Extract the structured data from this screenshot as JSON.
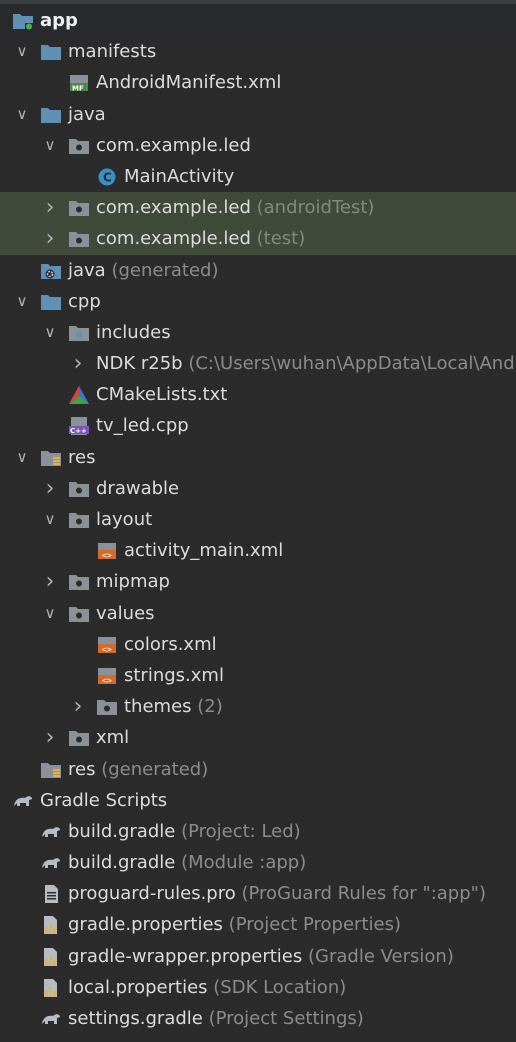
{
  "rows": [
    {
      "label": "app",
      "hint": "",
      "icon": "module-folder-icon",
      "arrow": "none",
      "level": 0,
      "bold": true
    },
    {
      "label": "manifests",
      "hint": "",
      "icon": "folder-icon",
      "arrow": "down",
      "level": 1
    },
    {
      "label": "AndroidManifest.xml",
      "hint": "",
      "icon": "manifest-file-icon",
      "arrow": "none",
      "level": 2
    },
    {
      "label": "java",
      "hint": "",
      "icon": "folder-icon",
      "arrow": "down",
      "level": 1
    },
    {
      "label": "com.example.led",
      "hint": "",
      "icon": "package-icon",
      "arrow": "down",
      "level": 2
    },
    {
      "label": "MainActivity",
      "hint": "",
      "icon": "class-icon",
      "arrow": "none",
      "level": 3
    },
    {
      "label": "com.example.led",
      "hint": "(androidTest)",
      "icon": "package-icon",
      "arrow": "right",
      "level": 2,
      "highlight": true
    },
    {
      "label": "com.example.led",
      "hint": "(test)",
      "icon": "package-icon",
      "arrow": "right",
      "level": 2,
      "highlight": true
    },
    {
      "label": "java",
      "hint": "(generated)",
      "icon": "generated-folder-icon",
      "arrow": "none",
      "level": 1
    },
    {
      "label": "cpp",
      "hint": "",
      "icon": "folder-icon",
      "arrow": "down",
      "level": 1
    },
    {
      "label": "includes",
      "hint": "",
      "icon": "include-folder-icon",
      "arrow": "down",
      "level": 2
    },
    {
      "label": "NDK r25b",
      "hint": "(C:\\Users\\wuhan\\AppData\\Local\\Android",
      "icon": "none",
      "arrow": "right",
      "level": 3
    },
    {
      "label": "CMakeLists.txt",
      "hint": "",
      "icon": "cmake-icon",
      "arrow": "none",
      "level": 2
    },
    {
      "label": "tv_led.cpp",
      "hint": "",
      "icon": "cpp-file-icon",
      "arrow": "none",
      "level": 2
    },
    {
      "label": "res",
      "hint": "",
      "icon": "res-folder-icon",
      "arrow": "down",
      "level": 1
    },
    {
      "label": "drawable",
      "hint": "",
      "icon": "package-icon",
      "arrow": "right",
      "level": 2
    },
    {
      "label": "layout",
      "hint": "",
      "icon": "package-icon",
      "arrow": "down",
      "level": 2
    },
    {
      "label": "activity_main.xml",
      "hint": "",
      "icon": "layout-xml-icon",
      "arrow": "none",
      "level": 3
    },
    {
      "label": "mipmap",
      "hint": "",
      "icon": "package-icon",
      "arrow": "right",
      "level": 2
    },
    {
      "label": "values",
      "hint": "",
      "icon": "package-icon",
      "arrow": "down",
      "level": 2
    },
    {
      "label": "colors.xml",
      "hint": "",
      "icon": "values-xml-icon",
      "arrow": "none",
      "level": 3
    },
    {
      "label": "strings.xml",
      "hint": "",
      "icon": "values-xml-icon",
      "arrow": "none",
      "level": 3
    },
    {
      "label": "themes",
      "hint": "(2)",
      "icon": "package-icon",
      "arrow": "right",
      "level": 3
    },
    {
      "label": "xml",
      "hint": "",
      "icon": "package-icon",
      "arrow": "right",
      "level": 2
    },
    {
      "label": "res",
      "hint": "(generated)",
      "icon": "res-folder-icon",
      "arrow": "none",
      "level": 1
    },
    {
      "label": "Gradle Scripts",
      "hint": "",
      "icon": "gradle-icon",
      "arrow": "none",
      "level": 0
    },
    {
      "label": "build.gradle",
      "hint": "(Project: Led)",
      "icon": "gradle-icon",
      "arrow": "none",
      "level": 1
    },
    {
      "label": "build.gradle",
      "hint": "(Module :app)",
      "icon": "gradle-icon",
      "arrow": "none",
      "level": 1
    },
    {
      "label": "proguard-rules.pro",
      "hint": "(ProGuard Rules for \":app\")",
      "icon": "text-file-icon",
      "arrow": "none",
      "level": 1
    },
    {
      "label": "gradle.properties",
      "hint": "(Project Properties)",
      "icon": "properties-icon",
      "arrow": "none",
      "level": 1
    },
    {
      "label": "gradle-wrapper.properties",
      "hint": "(Gradle Version)",
      "icon": "properties-icon",
      "arrow": "none",
      "level": 1
    },
    {
      "label": "local.properties",
      "hint": "(SDK Location)",
      "icon": "properties-icon",
      "arrow": "none",
      "level": 1
    },
    {
      "label": "settings.gradle",
      "hint": "(Project Settings)",
      "icon": "gradle-icon",
      "arrow": "none",
      "level": 1
    }
  ],
  "colors": {
    "background": "#2b2b2b",
    "highlight": "#3f4a3a",
    "folder": "#5f91b7",
    "text": "#dcdcdc",
    "hint": "#8c8c8c"
  }
}
